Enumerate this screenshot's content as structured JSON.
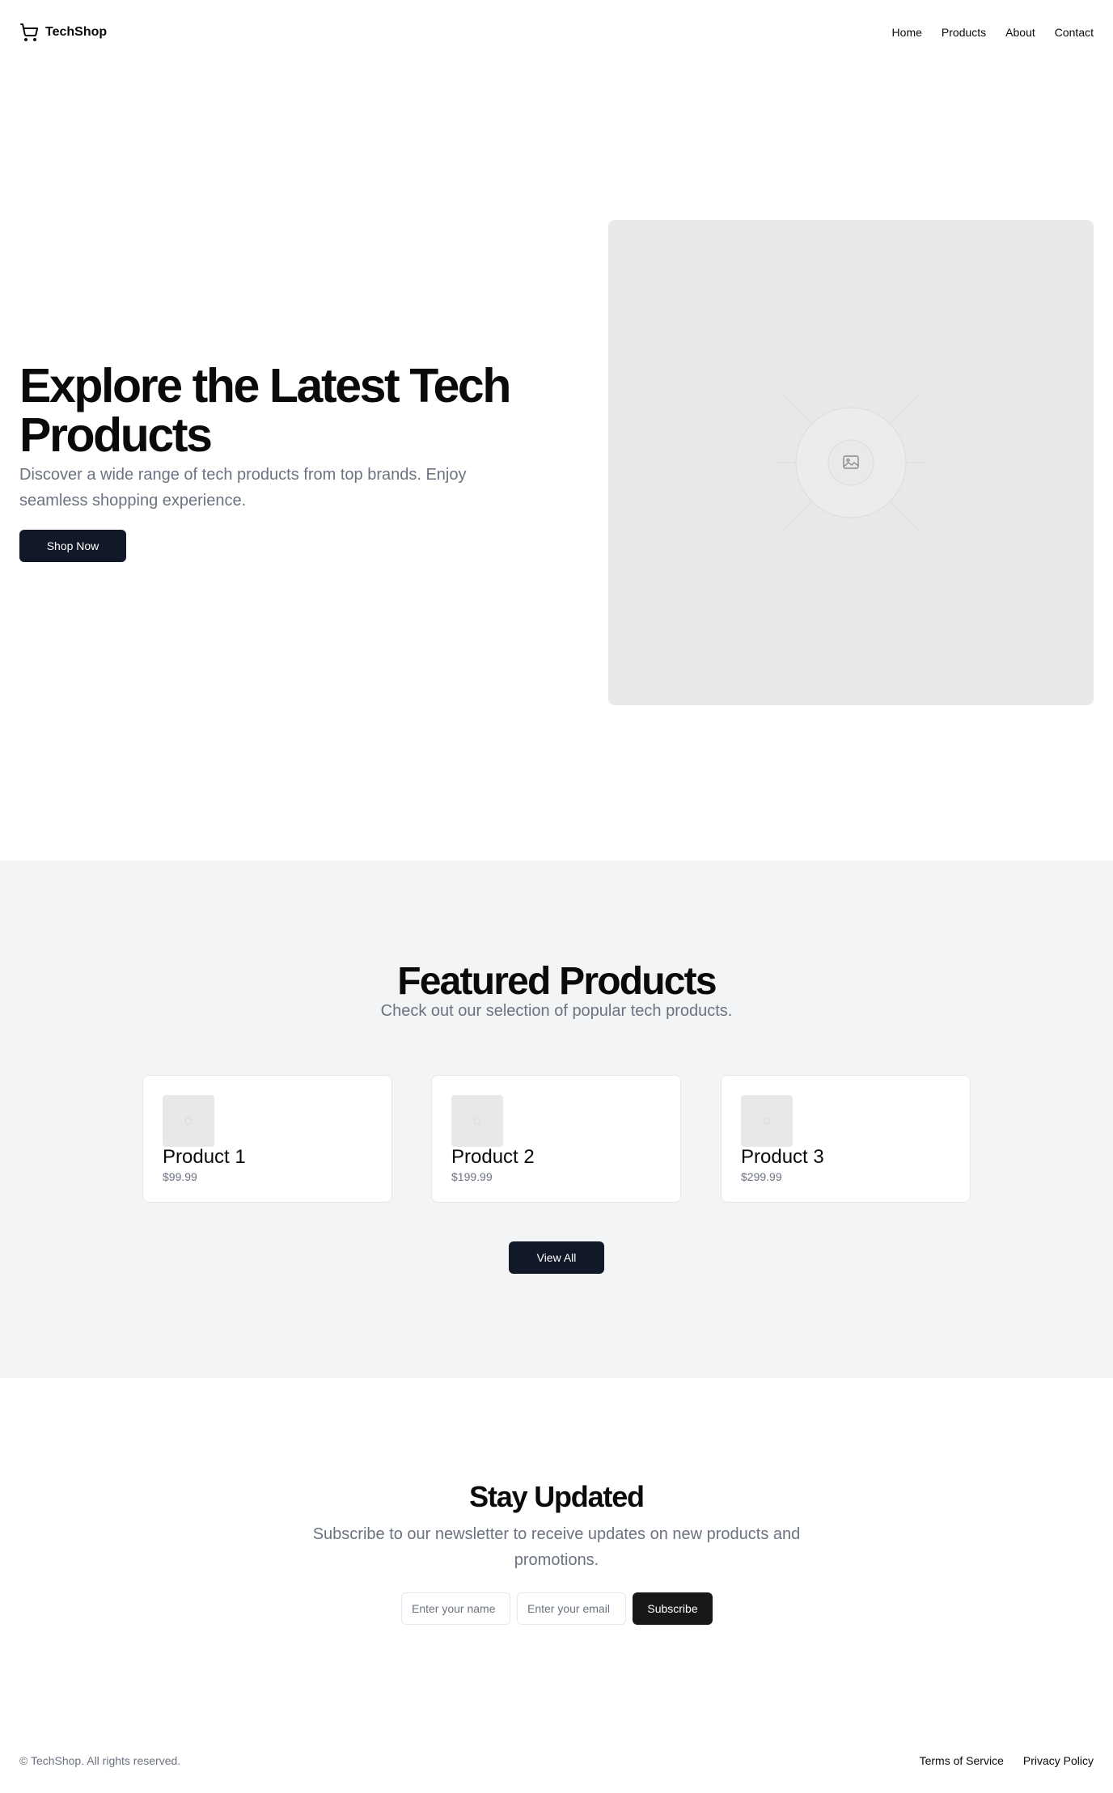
{
  "header": {
    "brand": "TechShop",
    "brand_icon": "shopping-cart-icon",
    "nav": [
      {
        "label": "Home"
      },
      {
        "label": "Products"
      },
      {
        "label": "About"
      },
      {
        "label": "Contact"
      }
    ]
  },
  "hero": {
    "title": "Explore the Latest Tech Products",
    "description": "Discover a wide range of tech products from top brands. Enjoy seamless shopping experience.",
    "cta": "Shop Now",
    "image_icon": "image-placeholder-icon"
  },
  "featured": {
    "title": "Featured Products",
    "subtitle": "Check out our selection of popular tech products.",
    "products": [
      {
        "name": "Product 1",
        "price": "$99.99"
      },
      {
        "name": "Product 2",
        "price": "$199.99"
      },
      {
        "name": "Product 3",
        "price": "$299.99"
      }
    ],
    "view_all": "View All"
  },
  "newsletter": {
    "title": "Stay Updated",
    "subtitle": "Subscribe to our newsletter to receive updates on new products and promotions.",
    "name_placeholder": "Enter your name",
    "email_placeholder": "Enter your email",
    "submit": "Subscribe"
  },
  "footer": {
    "copyright": "© TechShop. All rights reserved.",
    "links": [
      {
        "label": "Terms of Service"
      },
      {
        "label": "Privacy Policy"
      }
    ]
  },
  "colors": {
    "primary_button": "#111827",
    "muted_text": "#6b7280",
    "section_bg": "#f3f4f6",
    "placeholder_bg": "#e8e8e8"
  }
}
